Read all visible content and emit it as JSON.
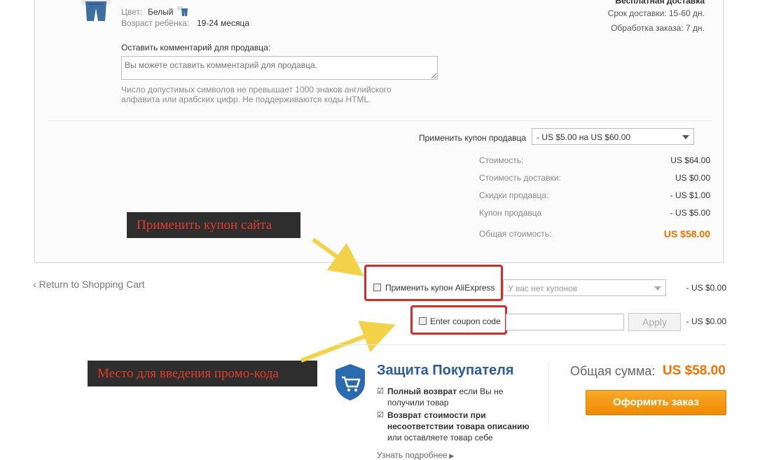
{
  "product": {
    "color_label": "Цвет:",
    "color_value": "Белый",
    "age_label": "Возраст ребёнка:",
    "age_value": "19-24 месяца"
  },
  "shipping": {
    "free_label": "Бесплатная доставка",
    "delivery_time": "Срок доставки: 15-60 дн.",
    "processing_time": "Обработка заказа: 7 дн."
  },
  "comment": {
    "label": "Оставить комментарий для продавца:",
    "placeholder": "Вы можете оставить комментарий для продавца.",
    "hint_line1": "Число допустимых символов не превышает 1000 знаков английского",
    "hint_line2": "алфавита или арабских цифр. Не поддерживаются коды HTML."
  },
  "seller_coupon": {
    "label": "Применить купон продавца",
    "selected": "- US $5.00 на US $60.00"
  },
  "summary": {
    "rows": [
      {
        "label": "Стоимость:",
        "value": "US $64.00"
      },
      {
        "label": "Стоимость доставки:",
        "value": "US $0.00"
      },
      {
        "label": "Скидки продавца:",
        "value": "- US $1.00"
      },
      {
        "label": "Купон продавца",
        "value": "- US $5.00"
      }
    ],
    "total_label": "Общая стоимость:",
    "total_value": "US $58.00"
  },
  "annotations": {
    "site_coupon": "Применить купон сайта",
    "promo_code": "Место для введения промо-кода"
  },
  "return_link": "Return to Shopping Cart",
  "aliexpress_coupon": {
    "label": "Применить купон AliExpress",
    "selected": "У вас нет купонов",
    "amount": "- US $0.00"
  },
  "coupon_code": {
    "label": "Enter coupon code",
    "apply": "Apply",
    "amount": "- US $0.00"
  },
  "protection": {
    "title": "Защита Покупателя",
    "item1_bold": "Полный возврат",
    "item1_rest": " если Вы не",
    "item1_line2": "получили товар",
    "item2_line1": "Возврат стоимости при",
    "item2_line2": "несоответствии товара описанию",
    "item2_line3": "или оставляете товар себе",
    "more": "Узнать подробнее"
  },
  "grand_total": {
    "label": "Общая сумма:",
    "value": "US $58.00",
    "button": "Оформить заказ"
  },
  "colors": {
    "accent_orange": "#f57200",
    "annotation_red": "#d62b2b",
    "protect_blue": "#2a5ba0"
  }
}
